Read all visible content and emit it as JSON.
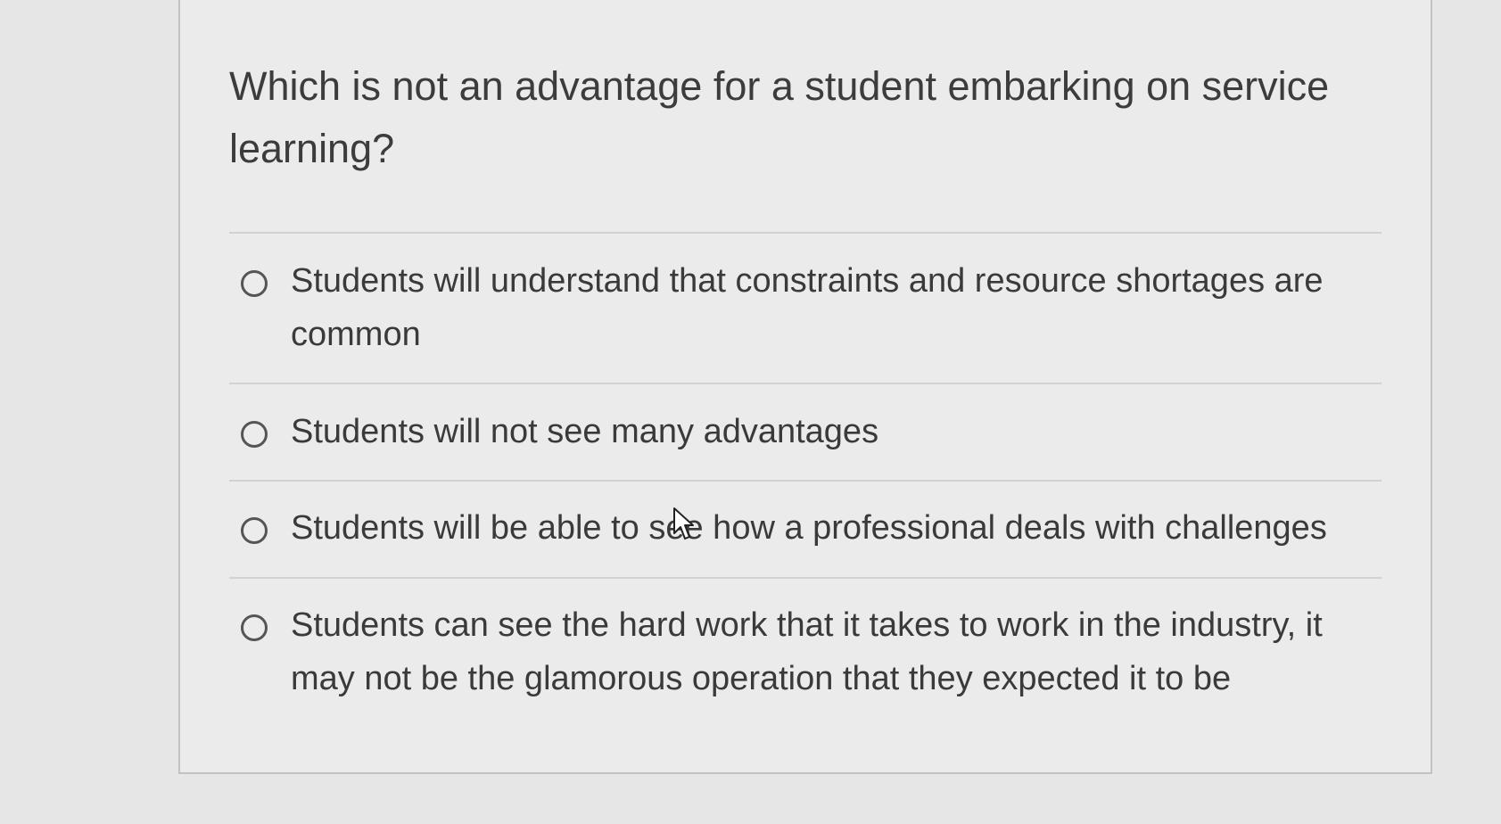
{
  "question": {
    "text": "Which is not an advantage for a student embarking on service learning?"
  },
  "options": [
    {
      "label": "Students will understand that constraints and resource shortages are common"
    },
    {
      "label": "Students will not see many advantages"
    },
    {
      "label": "Students will be able to see how a professional deals with challenges"
    },
    {
      "label": "Students can see the hard work that it takes to work in the industry, it may not be the glamorous operation that they expected it to be"
    }
  ],
  "colors": {
    "background": "#e6e6e6",
    "card": "#ebebeb",
    "text": "#3a3a3a",
    "radio_border": "#555555"
  }
}
